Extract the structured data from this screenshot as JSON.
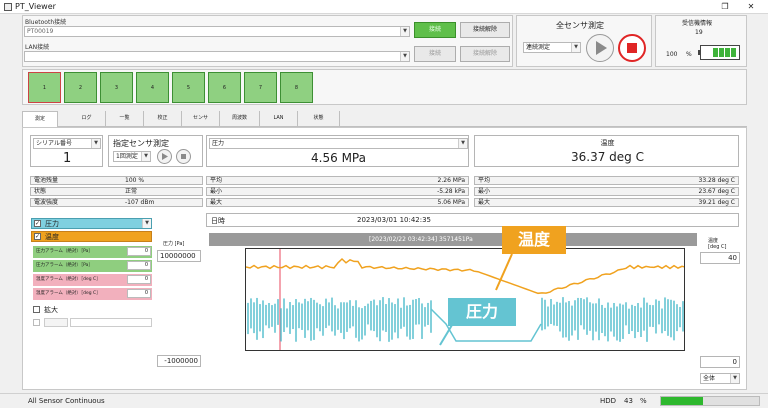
{
  "window": {
    "title": "PT_Viewer",
    "restore_glyph": "❐",
    "close_glyph": "✕"
  },
  "bluetooth": {
    "label": "Bluetooth接続",
    "device": "PT00019",
    "connect": "接続",
    "disconnect": "接続解除"
  },
  "lan": {
    "label": "LAN接続",
    "device": "",
    "connect": "接続",
    "disconnect": "接続解除"
  },
  "all_sensor": {
    "title": "全センサ測定",
    "mode": "連続測定"
  },
  "receiver": {
    "title": "受信機情報",
    "id": "19",
    "battery_value": "100",
    "battery_unit": "%"
  },
  "slots": [
    "1",
    "2",
    "3",
    "4",
    "5",
    "6",
    "7",
    "8"
  ],
  "tabs": [
    "測定",
    "ログ",
    "一覧",
    "校正",
    "センサ",
    "周波数",
    "LAN",
    "状態"
  ],
  "serial": {
    "label": "シリアル番号",
    "value": "1"
  },
  "specified": {
    "title": "指定センサ測定",
    "mode": "1回測定"
  },
  "pressure": {
    "label": "圧力",
    "value": "4.56 MPa"
  },
  "temperature": {
    "label": "温度",
    "value": "36.37  deg C"
  },
  "status": [
    {
      "label": "電池残量",
      "value": "100 %"
    },
    {
      "label": "状態",
      "value": "正常"
    },
    {
      "label": "電波強度",
      "value": "-107 dBm"
    }
  ],
  "pressure_stats": [
    {
      "label": "平均",
      "value": "2.26 MPa"
    },
    {
      "label": "最小",
      "value": "-5.28 kPa"
    },
    {
      "label": "最大",
      "value": "5.06 MPa"
    }
  ],
  "temperature_stats": [
    {
      "label": "平均",
      "value": "33.28 deg C"
    },
    {
      "label": "最小",
      "value": "23.67 deg C"
    },
    {
      "label": "最大",
      "value": "39.21 deg C"
    }
  ],
  "datetime": {
    "label": "日時",
    "value": "2023/03/01 10:42:35"
  },
  "series_select": {
    "pressure": "圧力",
    "temperature": "温度"
  },
  "alarms": [
    {
      "label": "圧力アラーム（絶対）［Pa］",
      "value": "0",
      "color": "#8fce7f"
    },
    {
      "label": "圧力アラーム（絶対）［Pa］",
      "value": "0",
      "color": "#8fce7f"
    },
    {
      "label": "温度アラーム（絶対）［deg C］",
      "value": "0",
      "color": "#f2b0bd"
    },
    {
      "label": "温度アラーム（絶対）［deg C］",
      "value": "0",
      "color": "#f2b0bd"
    }
  ],
  "zoom": {
    "label": "拡大"
  },
  "pressure_axis": {
    "label": "圧力 [Pa]",
    "max": "10000000",
    "min": "-1000000"
  },
  "temperature_axis": {
    "label": "温度\n[deg C]",
    "max": "40",
    "min": "0"
  },
  "chart_header": "[2023/02/22 03:42:34]  3571451Pa",
  "callouts": {
    "temperature": "温度",
    "pressure": "圧力"
  },
  "scope": "全体",
  "footer": {
    "status": "All Sensor Continuous",
    "hdd_label": "HDD",
    "hdd_value": "43",
    "hdd_unit": "%",
    "hdd_fraction": 0.43
  },
  "colors": {
    "pressure": "#64c4d2",
    "temperature": "#f0a21f",
    "accent_green": "#5fbf4a"
  }
}
